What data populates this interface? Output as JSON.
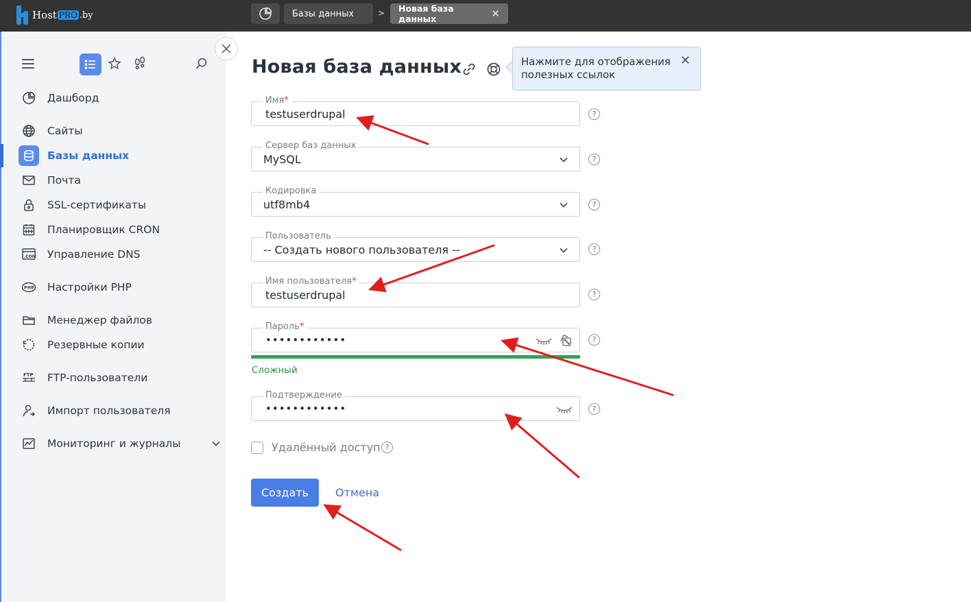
{
  "app": {
    "logo_host": "Host",
    "logo_pro": "PRO",
    "logo_by": ".by"
  },
  "breadcrumbs": {
    "items": [
      "Базы данных",
      "Новая база данных"
    ]
  },
  "sidebar": {
    "items": [
      {
        "label": "Дашборд",
        "icon": "dashboard-icon"
      },
      {
        "label": "Сайты",
        "icon": "globe-icon"
      },
      {
        "label": "Базы данных",
        "icon": "database-icon",
        "active": true
      },
      {
        "label": "Почта",
        "icon": "mail-icon"
      },
      {
        "label": "SSL-сертификаты",
        "icon": "lock-icon"
      },
      {
        "label": "Планировщик CRON",
        "icon": "calendar-icon"
      },
      {
        "label": "Управление DNS",
        "icon": "dns-icon"
      },
      {
        "label": "Настройки PHP",
        "icon": "php-icon"
      },
      {
        "label": "Менеджер файлов",
        "icon": "folder-icon"
      },
      {
        "label": "Резервные копии",
        "icon": "backup-icon"
      },
      {
        "label": "FTP-пользователи",
        "icon": "ftp-icon"
      },
      {
        "label": "Импорт пользователя",
        "icon": "user-import-icon"
      },
      {
        "label": "Мониторинг и журналы",
        "icon": "monitoring-icon"
      }
    ],
    "monitoring_icon_text": "PHP",
    "dns_icon_text": ".COM",
    "ftp_icon_text": "FTP"
  },
  "main": {
    "title": "Новая база данных",
    "hint": "Нажмите для отображения полезных ссылок",
    "form": {
      "name": {
        "label": "Имя",
        "required": "*",
        "value": "testuserdrupal"
      },
      "server": {
        "label": "Сервер баз данных",
        "value": "MySQL"
      },
      "encoding": {
        "label": "Кодировка",
        "value": "utf8mb4"
      },
      "user": {
        "label": "Пользователь",
        "value": "-- Создать нового пользователя --"
      },
      "username": {
        "label": "Имя пользователя",
        "required": "*",
        "value": "testuserdrupal"
      },
      "password": {
        "label": "Пароль",
        "required": "*",
        "value": "••••••••••••",
        "strength": "Сложный",
        "strength_level": 1.0
      },
      "confirm": {
        "label": "Подтверждение",
        "value": "••••••••••••"
      },
      "remote_access": {
        "label": "Удалённый доступ",
        "checked": false
      },
      "help_mark": "?"
    },
    "buttons": {
      "create": "Создать",
      "cancel": "Отмена"
    }
  },
  "colors": {
    "accent": "#4a7ee6",
    "topbar": "#333333",
    "strength": "#2ea357",
    "annotation": "#e01e1e"
  }
}
